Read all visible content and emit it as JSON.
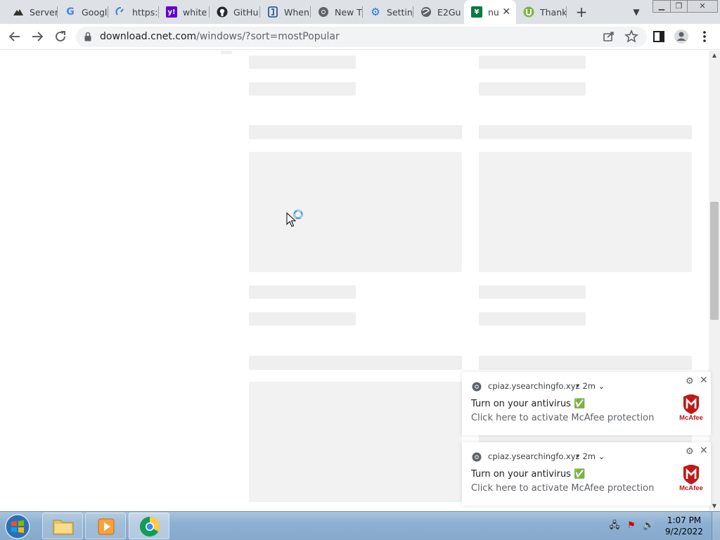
{
  "browser": {
    "tabs": [
      {
        "title": "Server",
        "icon": "server-icon"
      },
      {
        "title": "Google",
        "icon": "google-icon"
      },
      {
        "title": "https:",
        "icon": "speed-icon"
      },
      {
        "title": "white",
        "icon": "yahoo-icon"
      },
      {
        "title": "GitHu",
        "icon": "github-icon"
      },
      {
        "title": "When",
        "icon": "bracket-icon"
      },
      {
        "title": "New T",
        "icon": "chrome-icon"
      },
      {
        "title": "Settin",
        "icon": "settings-icon"
      },
      {
        "title": "E2Gu",
        "icon": "globe-icon"
      },
      {
        "title": "nu",
        "icon": "cnet-icon",
        "active": true
      },
      {
        "title": "Thank",
        "icon": "utorrent-icon"
      }
    ],
    "new_tab_label": "+",
    "url_domain": "download.cnet.com",
    "url_path": "/windows/?sort=mostPopular"
  },
  "notifications": [
    {
      "source": "cpiaz.ysearchingfo.xyz",
      "time": "• 2m ⌄",
      "title": "Turn on your antivirus ✅",
      "message": "Click here to activate McAfee protection",
      "logo_text": "McAfee"
    },
    {
      "source": "cpiaz.ysearchingfo.xyz",
      "time": "• 2m ⌄",
      "title": "Turn on your antivirus ✅",
      "message": "Click here to activate McAfee protection",
      "logo_text": "McAfee"
    }
  ],
  "taskbar": {
    "time": "1:07 PM",
    "date": "9/2/2022"
  },
  "colors": {
    "mcafee_red": "#c01818",
    "chrome_tabstrip": "#dee1e6",
    "skeleton": "#efefef"
  }
}
